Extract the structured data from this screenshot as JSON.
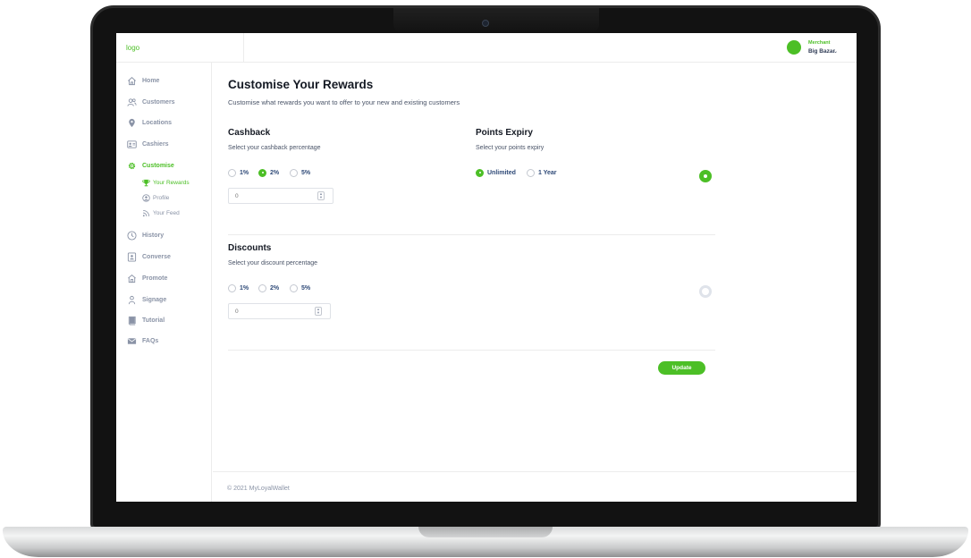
{
  "topbar": {
    "logo": "logo",
    "merchant_role": "Merchant",
    "merchant_name": "Big Bazar"
  },
  "sidebar": {
    "items": [
      {
        "label": "Home",
        "icon": "home-icon"
      },
      {
        "label": "Customers",
        "icon": "users-icon"
      },
      {
        "label": "Locations",
        "icon": "location-pin-icon"
      },
      {
        "label": "Cashiers",
        "icon": "id-card-icon"
      },
      {
        "label": "Customise",
        "icon": "gear-icon",
        "active": true
      },
      {
        "label": "History",
        "icon": "clock-icon"
      },
      {
        "label": "Converse",
        "icon": "chat-icon"
      },
      {
        "label": "Promote",
        "icon": "storefront-icon"
      },
      {
        "label": "Signage",
        "icon": "person-icon"
      },
      {
        "label": "Tutorial",
        "icon": "book-icon"
      },
      {
        "label": "FAQs",
        "icon": "mail-icon"
      }
    ],
    "sub_items": [
      {
        "label": "Your Rewards",
        "icon": "trophy-icon",
        "active": true
      },
      {
        "label": "Profile",
        "icon": "profile-icon"
      },
      {
        "label": "Your Feed",
        "icon": "rss-icon"
      }
    ]
  },
  "main": {
    "title": "Customise Your Rewards",
    "subtitle": "Customise what rewards you want to offer to your new and existing customers",
    "cashback": {
      "title": "Cashback",
      "subtitle": "Select your cashback percentage",
      "options": [
        "1%",
        "2%",
        "5%"
      ],
      "selected": "2%",
      "input_placeholder": "0",
      "enabled": true
    },
    "points_expiry": {
      "title": "Points Expiry",
      "subtitle": "Select your points expiry",
      "options": [
        "Unlimited",
        "1 Year"
      ],
      "selected": "Unlimited"
    },
    "discounts": {
      "title": "Discounts",
      "subtitle": "Select your discount percentage",
      "options": [
        "1%",
        "2%",
        "5%"
      ],
      "selected": null,
      "input_placeholder": "0",
      "enabled": false
    },
    "update_label": "Update"
  },
  "footer": {
    "text": "© 2021 MyLoyalWallet"
  },
  "colors": {
    "accent": "#4cbf26",
    "text_dark": "#151a24",
    "nav_text": "#8a93a6",
    "option_text": "#2f4a78"
  }
}
